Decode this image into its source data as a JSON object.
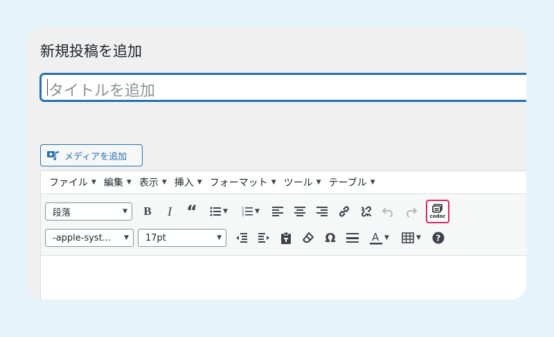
{
  "page": {
    "heading": "新規投稿を追加",
    "title_placeholder": "タイトルを追加",
    "media_button": "メディアを追加"
  },
  "menubar": [
    "ファイル",
    "編集",
    "表示",
    "挿入",
    "フォーマット",
    "ツール",
    "テーブル"
  ],
  "toolbar": {
    "paragraph_select": "段落",
    "font_family_select": "-apple-syst...",
    "font_size_select": "17pt",
    "codoc_label": "codoc"
  }
}
